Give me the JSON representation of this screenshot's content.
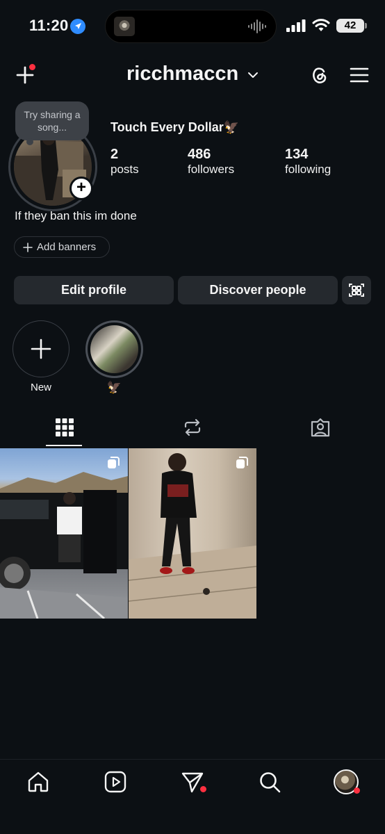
{
  "status_bar": {
    "time": "11:20",
    "battery": "42",
    "icons": [
      "location-arrow-icon",
      "album-art-icon",
      "waveform-icon",
      "cellular-signal-icon",
      "wifi-icon",
      "battery-icon"
    ]
  },
  "header": {
    "username": "ricchmaccn",
    "icons": [
      "create-plus-icon",
      "chevron-down-icon",
      "threads-icon",
      "hamburger-menu-icon"
    ]
  },
  "profile": {
    "note_placeholder": "Try sharing a song...",
    "display_name": "Touch Every Dollar🦅",
    "stats": [
      {
        "value": "2",
        "label": "posts"
      },
      {
        "value": "486",
        "label": "followers"
      },
      {
        "value": "134",
        "label": "following"
      }
    ],
    "bio": "If they ban this im done",
    "add_banners_label": "Add banners"
  },
  "actions": {
    "edit_profile": "Edit profile",
    "discover_people": "Discover people"
  },
  "highlights": {
    "new_label": "New",
    "items": [
      {
        "label": "🦅"
      }
    ]
  },
  "tabs": [
    "grid-icon",
    "reposts-icon",
    "tagged-icon"
  ],
  "bottom_nav": [
    "home-icon",
    "reels-icon",
    "messages-icon",
    "search-icon",
    "profile-avatar"
  ],
  "colors": {
    "background": "#0c1014",
    "button_bg": "#25292e",
    "notification_red": "#ff3040"
  }
}
